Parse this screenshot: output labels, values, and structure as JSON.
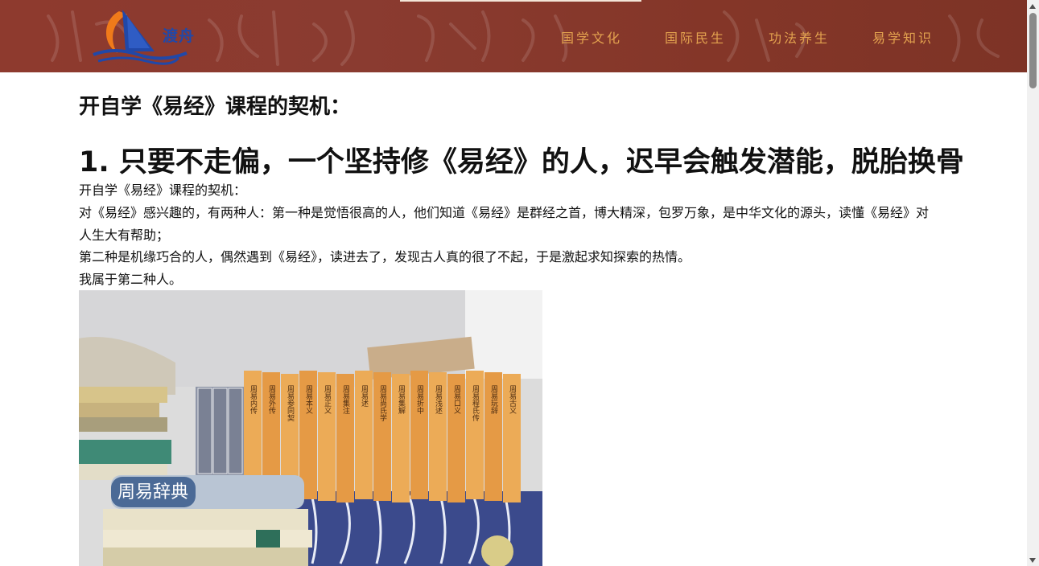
{
  "header": {
    "logo_text": "渡舟",
    "nav": [
      {
        "label": "国学文化"
      },
      {
        "label": "国际民生"
      },
      {
        "label": "功法养生"
      },
      {
        "label": "易学知识"
      }
    ]
  },
  "article": {
    "intro_heading": "开自学《易经》课程的契机：",
    "main_heading": "1. 只要不走偏，一个坚持修《易经》的人，迟早会触发潜能，脱胎换骨",
    "paragraphs": [
      "开自学《易经》课程的契机：",
      "对《易经》感兴趣的，有两种人：第一种是觉悟很高的人，他们知道《易经》是群经之首，博大精深，包罗万象，是中华文化的源头，读懂《易经》对人生大有帮助；",
      "第二种是机缘巧合的人，偶然遇到《易经》，读进去了，发现古人真的很了不起，于是激起求知探索的热情。",
      "我属于第二种人。"
    ],
    "photo_book_title": "周易辞典",
    "photo_spines": [
      "周易内传",
      "周易外传",
      "周易参同契",
      "周易本义",
      "周易正义",
      "周易集注",
      "周易述",
      "周易尚氏学",
      "周易集解",
      "周易折中",
      "周易浅述",
      "周易口义",
      "周易程氏传",
      "周易玩辞",
      "周易古义"
    ]
  },
  "colors": {
    "header_bg": "#8a3b30",
    "nav_text": "#e3a24f",
    "logo_blue": "#2148a8",
    "logo_orange": "#f07a1a"
  }
}
